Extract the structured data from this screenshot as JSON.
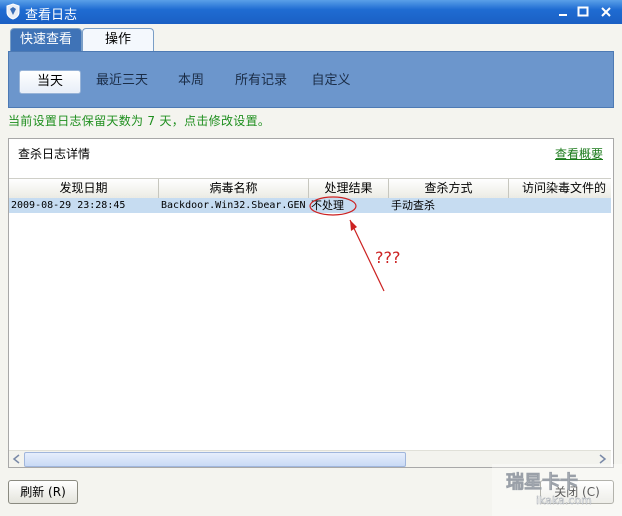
{
  "window": {
    "title": "查看日志"
  },
  "tabs": [
    {
      "label": "快速查看"
    },
    {
      "label": "操作"
    }
  ],
  "subtabs": [
    {
      "label": "当天"
    },
    {
      "label": "最近三天"
    },
    {
      "label": "本周"
    },
    {
      "label": "所有记录"
    },
    {
      "label": "自定义"
    }
  ],
  "notice": "当前设置日志保留天数为 7 天，点击修改设置。",
  "panel": {
    "title": "查杀日志详情",
    "overview_link": "查看概要"
  },
  "table": {
    "columns": [
      "发现日期",
      "病毒名称",
      "处理结果",
      "查杀方式",
      "访问染毒文件的"
    ],
    "rows": [
      {
        "date": "2009-08-29 23:28:45",
        "virus": "Backdoor.Win32.Sbear.GEN",
        "result": "不处理",
        "method": "手动查杀",
        "process": ""
      }
    ]
  },
  "annotation": {
    "text": "???",
    "color": "#cc2222"
  },
  "buttons": {
    "refresh": "刷新 (R)",
    "close": "关闭 (C)"
  },
  "watermark": {
    "text": "瑞星卡卡",
    "url": "ikaka.com"
  },
  "colors": {
    "titlebar": "#1f6cd2",
    "ribbon": "#6c96cc",
    "notice": "#1f8f1f",
    "selected_row": "#c6dcf1"
  }
}
